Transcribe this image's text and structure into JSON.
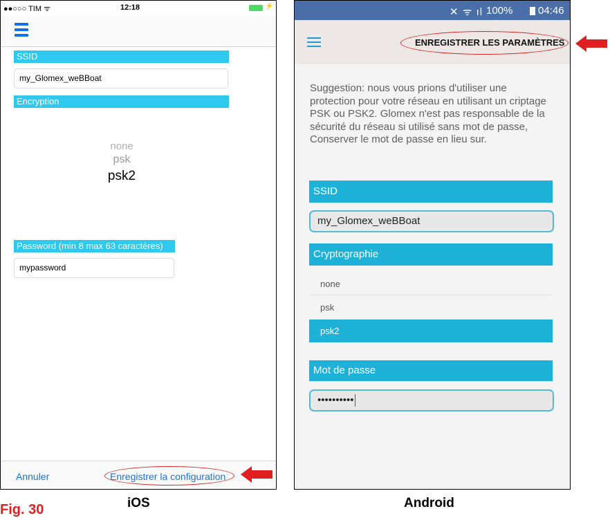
{
  "ios": {
    "status": {
      "carrier": "●●○○○ TIM ᯤ",
      "time": "12:18",
      "charge": "⚡"
    },
    "menu_icon": "hamburger-icon",
    "ssid_label": "SSID",
    "ssid_value": "my_Glomex_weBBoat",
    "encryption_label": "Encryption",
    "encryption_options": [
      "none",
      "psk",
      "psk2"
    ],
    "encryption_selected": "psk2",
    "password_label": "Password (min 8 max 63 caractères)",
    "password_value": "mypassword",
    "cancel_label": "Annuler",
    "save_label": "Enregistrer la configuration",
    "accent_color": "#1a73d9",
    "header_color": "#2fc8ee"
  },
  "android": {
    "status": {
      "icons": "✕ ᯤ ıl",
      "battery": "100%",
      "time": "04:46"
    },
    "menu_icon": "hamburger-icon",
    "save_label": "ENREGISTRER LES PARAMÈTRES",
    "suggestion": "Suggestion: nous vous prions d'utiliser une protection pour votre réseau en utilisant un criptage PSK ou PSK2. Glomex n'est pas responsable de la sécurité du réseau si utilisé sans mot de passe, Conserver le mot de passe en lieu sur.",
    "ssid_label": "SSID",
    "ssid_value": "my_Glomex_weBBoat",
    "crypto_label": "Cryptographie",
    "crypto_options": [
      "none",
      "psk",
      "psk2"
    ],
    "crypto_selected": "psk2",
    "password_label": "Mot de passe",
    "password_value": "••••••••••",
    "header_color": "#1fb2d9",
    "status_bar_color": "#4a6fa8"
  },
  "annotations": {
    "highlight_color": "#e02020",
    "arrow_icon": "red-arrow-left-icon"
  },
  "captions": {
    "ios": "iOS",
    "android": "Android",
    "figure": "Fig. 30"
  }
}
